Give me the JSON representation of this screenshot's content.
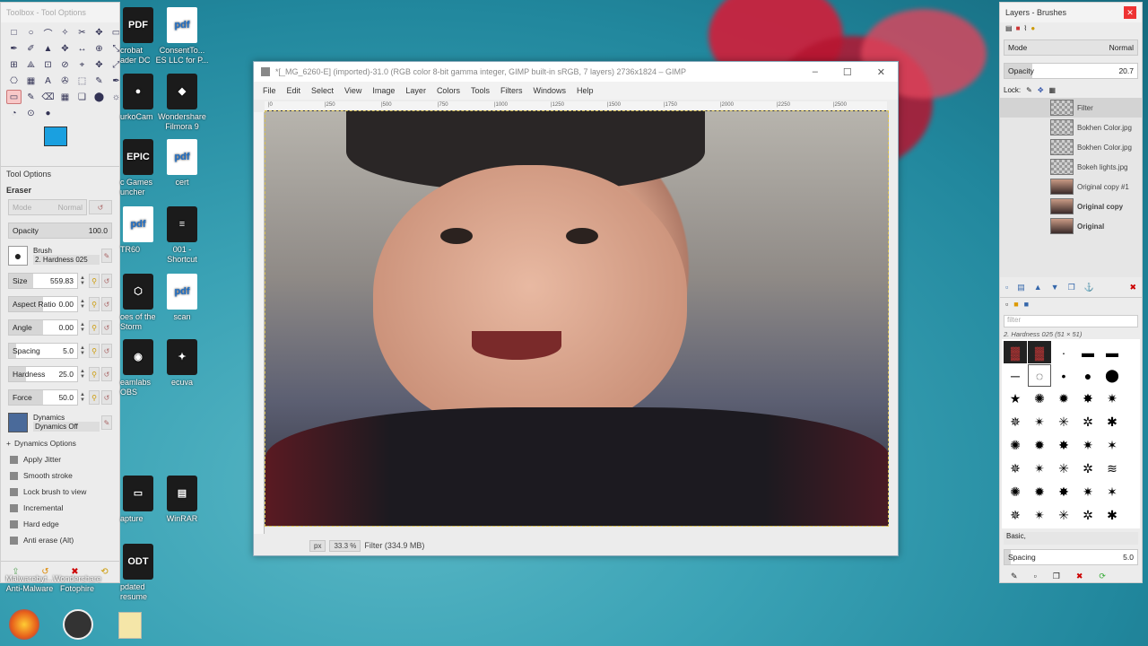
{
  "toolbox": {
    "title": "Toolbox - Tool Options",
    "panel_title": "Tool Options",
    "tool_name": "Eraser",
    "mode_label": "Mode",
    "mode_value": "Normal",
    "opacity_label": "Opacity",
    "opacity_value": "100.0",
    "brush_label": "Brush",
    "brush_value": "2. Hardness 025",
    "options": [
      {
        "label": "Size",
        "value": "559.83",
        "fill": 0.35
      },
      {
        "label": "Aspect Ratio",
        "value": "0.00",
        "fill": 0.5
      },
      {
        "label": "Angle",
        "value": "0.00",
        "fill": 0.5
      },
      {
        "label": "Spacing",
        "value": "5.0",
        "fill": 0.1
      },
      {
        "label": "Hardness",
        "value": "25.0",
        "fill": 0.25
      },
      {
        "label": "Force",
        "value": "50.0",
        "fill": 0.5
      }
    ],
    "dynamics_label": "Dynamics",
    "dynamics_value": "Dynamics Off",
    "dynamics_options": "Dynamics Options",
    "checks": [
      "Apply Jitter",
      "Smooth stroke",
      "Lock brush to view",
      "Incremental",
      "Hard edge",
      "Anti erase  (Alt)"
    ],
    "fg_color": "#1aa0e0",
    "bg_color": "#38b050"
  },
  "desktop_icons": [
    {
      "label": "crobat\nader DC",
      "glyph": "PDF"
    },
    {
      "label": "ConsentTo...\nES LLC for P...",
      "glyph": "pdf"
    },
    {
      "label": "urkoCam",
      "glyph": "●"
    },
    {
      "label": "Wondershare\nFilmora 9",
      "glyph": "◆"
    },
    {
      "label": "c Games\nuncher",
      "glyph": "EPIC"
    },
    {
      "label": "cert",
      "glyph": "pdf"
    },
    {
      "label": "TR60",
      "glyph": "pdf"
    },
    {
      "label": "001 -\nShortcut",
      "glyph": "≡"
    },
    {
      "label": "oes of the\nStorm",
      "glyph": "⬡"
    },
    {
      "label": "scan",
      "glyph": "pdf"
    },
    {
      "label": "eamlabs\nOBS",
      "glyph": "◉"
    },
    {
      "label": "ecuva",
      "glyph": "✦"
    },
    {
      "label": "apture",
      "glyph": "▭"
    },
    {
      "label": "WinRAR",
      "glyph": "▤"
    },
    {
      "label": "pdated\nresume",
      "glyph": "ODT"
    },
    {
      "label": "Malwarebyt...\nAnti-Malware",
      "glyph": ""
    },
    {
      "label": "Wondershare\nFotophire",
      "glyph": ""
    }
  ],
  "gimp": {
    "title": "*[_MG_6260-E] (imported)-31.0 (RGB color 8-bit gamma integer, GIMP built-in sRGB, 7 layers) 2736x1824 – GIMP",
    "menu": [
      "File",
      "Edit",
      "Select",
      "View",
      "Image",
      "Layer",
      "Colors",
      "Tools",
      "Filters",
      "Windows",
      "Help"
    ],
    "ruler_ticks": [
      "|0",
      "|250",
      "|500",
      "|750",
      "|1000",
      "|1250",
      "|1500",
      "|1750",
      "|2000",
      "|2250",
      "|2500"
    ],
    "unit": "px",
    "zoom": "33.3 %",
    "status_text": "Filter (334.9 MB)"
  },
  "layers_dock": {
    "title": "Layers - Brushes",
    "mode_label": "Mode",
    "mode_value": "Normal",
    "opacity_label": "Opacity",
    "opacity_value": "20.7",
    "lock_label": "Lock:",
    "layers": [
      "Filter",
      "Bokhen Color.jpg",
      "Bokhen Color.jpg",
      "Bokeh lights.jpg",
      "Original copy #1",
      "Original copy",
      "Original"
    ],
    "filter_placeholder": "filter",
    "brush_name": "2. Hardness 025 (51 × 51)",
    "brush_tag": "Basic,",
    "spacing_label": "Spacing",
    "spacing_value": "5.0"
  }
}
